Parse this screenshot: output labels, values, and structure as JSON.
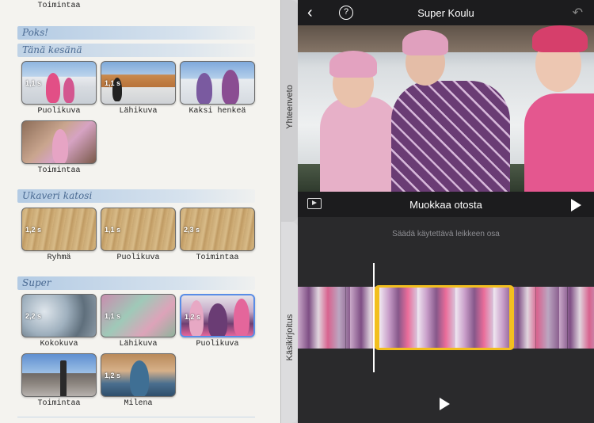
{
  "project": {
    "title": "Super Koulu"
  },
  "storyboard": {
    "top_clip_label": "Toimintaa",
    "sections": [
      {
        "title": "Poks!",
        "subsections": [
          {
            "title": "Tänä kesänä",
            "clips": [
              {
                "duration": "1,1 s",
                "label": "Puolikuva",
                "thumb": "snow-kids"
              },
              {
                "duration": "1,1 s",
                "label": "Lähikuva",
                "thumb": "school-building"
              },
              {
                "duration": "",
                "label": "Kaksi henkeä",
                "thumb": "kids-outdoor"
              },
              {
                "duration": "",
                "label": "Toimintaa",
                "thumb": "kids-indoor"
              }
            ]
          }
        ]
      },
      {
        "title": "Ukaveri katosi",
        "clips": [
          {
            "duration": "1,2 s",
            "label": "Ryhmä",
            "thumb": "wood-floor"
          },
          {
            "duration": "1,1 s",
            "label": "Puolikuva",
            "thumb": "wood-floor"
          },
          {
            "duration": "2,3 s",
            "label": "Toimintaa",
            "thumb": "wood-floor"
          }
        ]
      },
      {
        "title": "Super",
        "clips": [
          {
            "duration": "2,2 s",
            "label": "Kokokuva",
            "thumb": "ice"
          },
          {
            "duration": "1,1 s",
            "label": "Lähikuva",
            "thumb": "pink-blur"
          },
          {
            "duration": "1,2 s",
            "label": "Puolikuva",
            "thumb": "jackets",
            "selected": true
          },
          {
            "duration": "",
            "label": "Toimintaa",
            "thumb": "sunny-yard"
          },
          {
            "duration": "1,2 s",
            "label": "Milena",
            "thumb": "indoor-boy"
          }
        ]
      }
    ]
  },
  "side_tabs": {
    "summary": "Yhteenveto",
    "script": "Käsikirjoitus"
  },
  "editor": {
    "edit_clip_title": "Muokkaa otosta",
    "trim_hint": "Säädä käytettävä leikkeen osa"
  },
  "icons": {
    "back": "chevron-left-icon",
    "help": "question-circle-icon",
    "undo": "undo-icon",
    "preview": "preview-frame-icon",
    "play": "play-icon"
  },
  "colors": {
    "selection_border": "#f2bf1f",
    "selected_thumb_border": "#5a8de6",
    "section_banner": "#a8c4e2"
  }
}
